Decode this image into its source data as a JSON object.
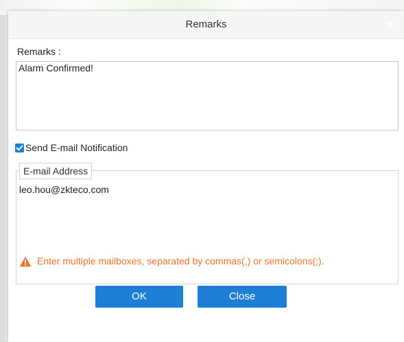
{
  "dialog": {
    "title": "Remarks",
    "close_symbol": "×"
  },
  "remarks": {
    "label": "Remarks :",
    "value": "Alarm Confirmed!"
  },
  "notification": {
    "label": "Send E-mail Notification",
    "checked": true
  },
  "email": {
    "legend": "E-mail Address",
    "value": "leo.hou@zkteco.com",
    "hint": "Enter multiple mailboxes, separated by commas(,) or semicolons(;)."
  },
  "buttons": {
    "ok": "OK",
    "close": "Close"
  },
  "colors": {
    "accent": "#1e7fd6",
    "warning": "#e8752b"
  },
  "icons": {
    "checkbox": "checkmark-icon",
    "hint": "warning-icon"
  }
}
